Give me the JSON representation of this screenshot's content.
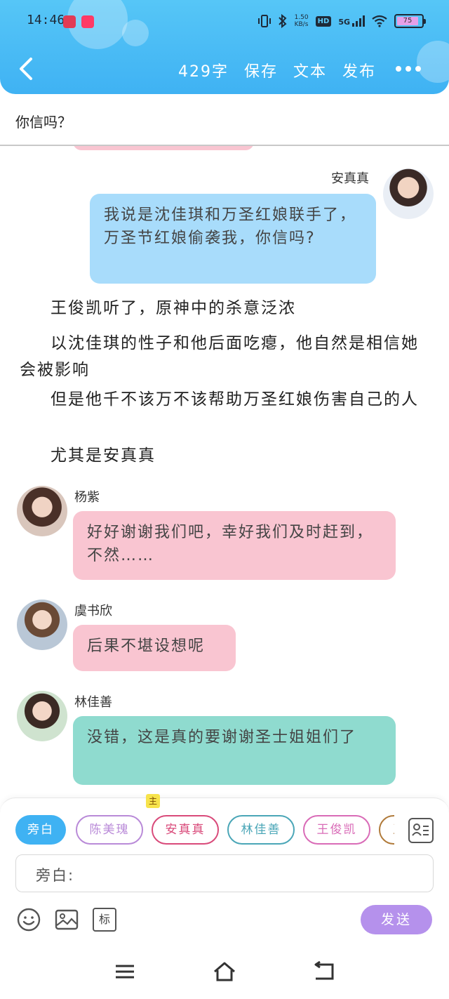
{
  "status_bar": {
    "time": "14:46",
    "net_speed_top": "1.50",
    "net_speed_bottom": "KB/s",
    "hd_label": "HD",
    "network": "5G",
    "battery": "75"
  },
  "toolbar": {
    "word_count": "429字",
    "save_label": "保存",
    "text_label": "文本",
    "publish_label": "发布"
  },
  "story_title": "你信吗？",
  "messages": [
    {
      "speaker": "安真真",
      "text": "我说是沈佳琪和万圣红娘联手了，万圣节红娘偷袭我，你信吗?"
    }
  ],
  "narration": [
    "王俊凯听了，原神中的杀意泛浓",
    "以沈佳琪的性子和他后面吃瘪，他自然是相信她会被影响",
    "但是他千不该万不该帮助万圣红娘伤害自己的人",
    "尤其是安真真"
  ],
  "replies": [
    {
      "speaker": "杨紫",
      "text": "好好谢谢我们吧，幸好我们及时赶到，不然……"
    },
    {
      "speaker": "虞书欣",
      "text": "后果不堪设想呢"
    },
    {
      "speaker": "林佳善",
      "text": "没错，这是真的要谢谢圣士姐姐们了"
    }
  ],
  "role_chips": [
    "旁白",
    "陈美瑰",
    "安真真",
    "林佳善",
    "王俊凯",
    "王"
  ],
  "main_badge": "主",
  "input": {
    "prefix": "旁白:"
  },
  "tools": {
    "tag_label": "标"
  },
  "send_label": "发送",
  "colors": {
    "header": "#3fb2f3",
    "bubble_blue": "#a8dcfb",
    "bubble_pink": "#f9c5d1",
    "bubble_teal": "#8fdbcf",
    "send": "#b591ec"
  }
}
